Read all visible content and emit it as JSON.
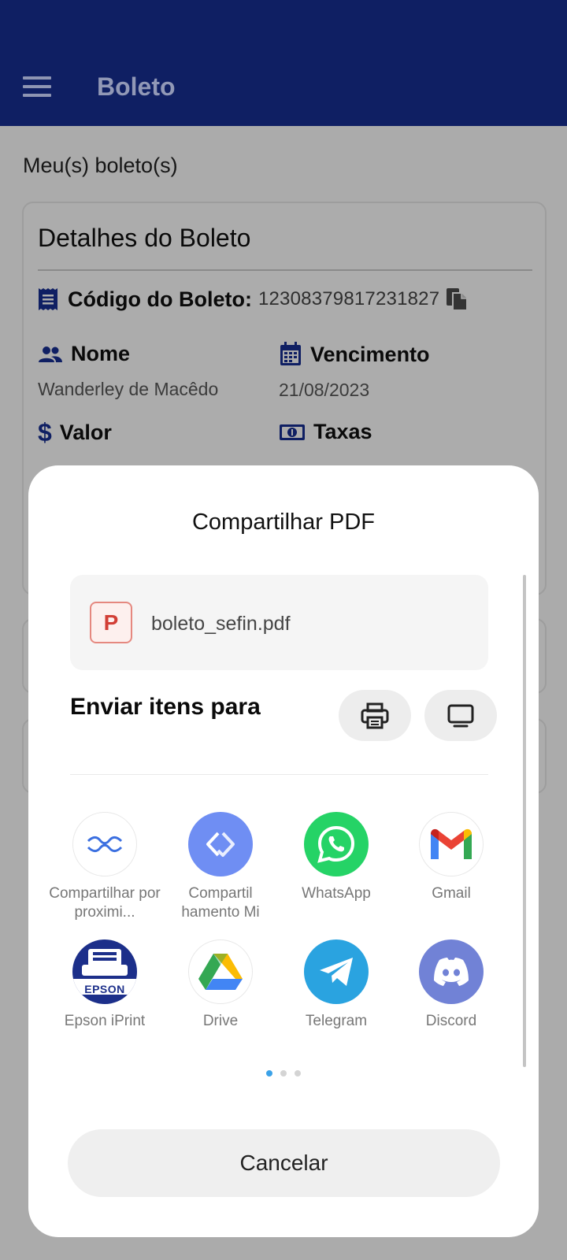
{
  "appbar": {
    "title": "Boleto",
    "color": "#0f1f63"
  },
  "page": {
    "subtitle": "Meu(s) boleto(s)"
  },
  "boleto_card": {
    "title": "Detalhes do Boleto",
    "code_label": "Código do Boleto:",
    "code_value": "12308379817231827",
    "fields": {
      "nome": {
        "label": "Nome",
        "value": "Wanderley de Macêdo"
      },
      "vencimento": {
        "label": "Vencimento",
        "value": "21/08/2023"
      },
      "valor": {
        "label": "Valor"
      },
      "taxas": {
        "label": "Taxas"
      }
    }
  },
  "share_sheet": {
    "title": "Compartilhar PDF",
    "file": {
      "icon_letter": "P",
      "name": "boleto_sefin.pdf"
    },
    "send_title": "Enviar itens para",
    "apps": [
      {
        "label": "Compartilhar por proximi...",
        "icon": "nearby-share-icon"
      },
      {
        "label": "Compartil hamento Mi",
        "icon": "mi-share-icon"
      },
      {
        "label": "WhatsApp",
        "icon": "whatsapp-icon"
      },
      {
        "label": "Gmail",
        "icon": "gmail-icon"
      },
      {
        "label": "Epson iPrint",
        "icon": "epson-iprint-icon",
        "badge": "EPSON"
      },
      {
        "label": "Drive",
        "icon": "google-drive-icon"
      },
      {
        "label": "Telegram",
        "icon": "telegram-icon"
      },
      {
        "label": "Discord",
        "icon": "discord-icon"
      }
    ],
    "page_indicator": {
      "count": 3,
      "active": 1
    },
    "cancel_label": "Cancelar"
  }
}
